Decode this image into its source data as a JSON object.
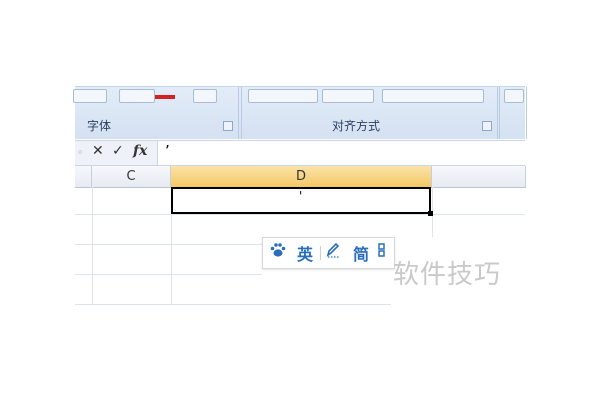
{
  "ribbon": {
    "font_group_label": "字体",
    "alignment_group_label": "对齐方式"
  },
  "formula_bar": {
    "cancel_glyph": "✕",
    "enter_glyph": "✓",
    "fx_label": "fx",
    "content": "’"
  },
  "grid": {
    "columns": [
      "C",
      "D"
    ],
    "selected_column": "D",
    "active_cell_text": "'"
  },
  "ime_toolbar": {
    "lang": "英",
    "charset": "简"
  },
  "watermark": "软件技巧",
  "colors": {
    "selected_header": "#f4c865",
    "ribbon_bg": "#dbe6f4",
    "ime_blue": "#2a6ebb"
  }
}
